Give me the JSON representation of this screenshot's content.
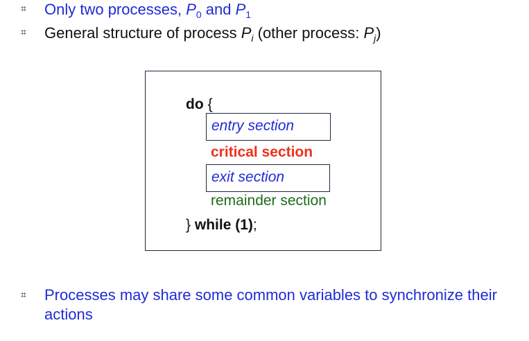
{
  "bullets": [
    {
      "prefix": "Only  two  processes, ",
      "p0": "P",
      "p0_sub": "0",
      "mid": " and ",
      "p1": "P",
      "p1_sub": "1"
    },
    {
      "prefix": "General structure of process ",
      "pi": "P",
      "pi_sub": "i",
      "mid": " (other process: ",
      "pj": "P",
      "pj_sub": "j",
      "suffix": ")"
    }
  ],
  "code": {
    "do_keyword": "do",
    "open_brace": "{",
    "entry_section": "entry section",
    "critical_section": "critical section",
    "exit_section": "exit section",
    "remainder_section": "remainder section",
    "close_brace": "}",
    "while_keyword": "while (1)",
    "semicolon": ";"
  },
  "footer_bullet": {
    "text": "Processes may share some common variables to synchronize their actions"
  },
  "colors": {
    "blue_text": "#1f2bd6",
    "critical_red": "#f0301c",
    "remainder_green": "#1c6b1c",
    "box_border": "#1b2a3a"
  },
  "icons": {
    "bullet": "square-hash-bullet-icon"
  }
}
